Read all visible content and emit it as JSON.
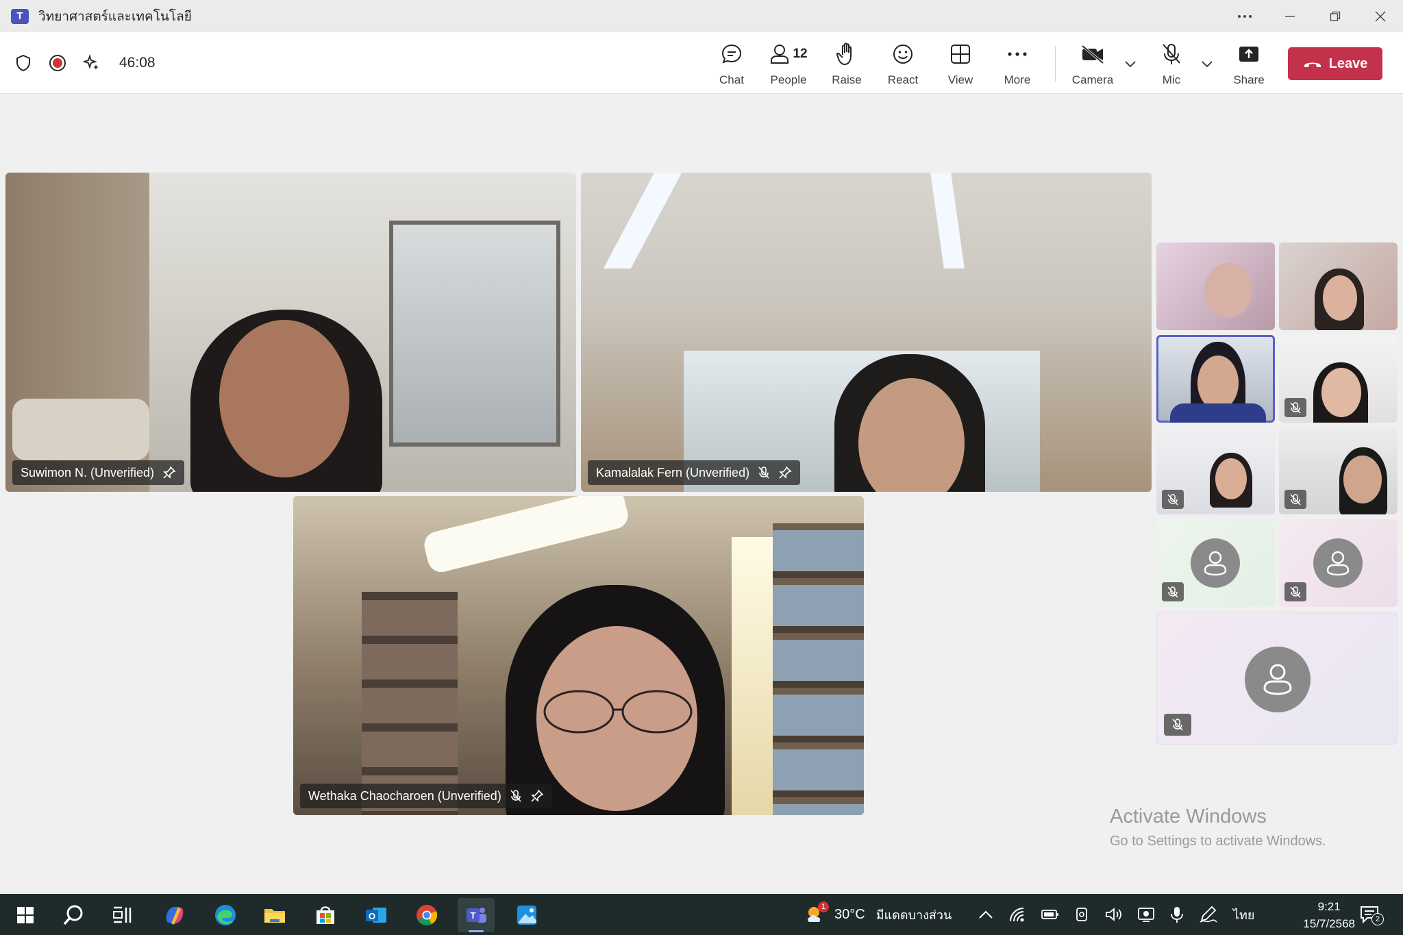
{
  "window": {
    "title": "วิทยาศาสตร์และเทคโนโลยี",
    "app_icon": "T"
  },
  "toolbar": {
    "timer": "46:08",
    "chat_label": "Chat",
    "people_label": "People",
    "people_count": "12",
    "raise_label": "Raise",
    "react_label": "React",
    "view_label": "View",
    "more_label": "More",
    "camera_label": "Camera",
    "mic_label": "Mic",
    "share_label": "Share",
    "leave_label": "Leave"
  },
  "stage": {
    "tiles": [
      {
        "name": "Suwimon N. (Unverified)"
      },
      {
        "name": "Kamalalak Fern (Unverified)"
      },
      {
        "name": "Wethaka Chaocharoen (Unverified)"
      }
    ]
  },
  "watermark": {
    "title": "Activate Windows",
    "subtitle": "Go to Settings to activate Windows."
  },
  "taskbar": {
    "weather_temp": "30°C",
    "weather_desc": "มีแดดบางส่วน",
    "weather_badge": "1",
    "language": "ไทย",
    "time": "9:21",
    "date": "15/7/2568",
    "notification_count": "2"
  },
  "colors": {
    "leave": "#c4314b",
    "accent": "#5b5fc7",
    "taskbar": "#1f2b2b"
  }
}
